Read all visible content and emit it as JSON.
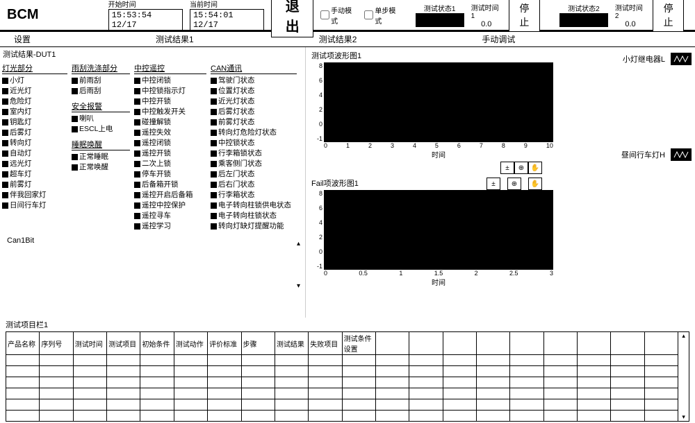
{
  "header": {
    "logo": "BCM",
    "start_time_label": "开始时间",
    "start_time": "15:53:54 12/17",
    "current_time_label": "当前时间",
    "current_time": "15:54:01 12/17",
    "exit": "退出",
    "manual_mode": "手动模式",
    "step_mode": "单步模式",
    "status1_label": "测试状态1",
    "time1_label": "测试时间1",
    "time1_val": "0.0",
    "stop1": "停止",
    "status2_label": "测试状态2",
    "time2_label": "测试时间2",
    "time2_val": "0.0",
    "stop2": "停止"
  },
  "tabs": {
    "t1": "设置",
    "t2": "测试结果1",
    "t3": "测试结果2",
    "t4": "手动调试"
  },
  "left": {
    "title": "测试结果-DUT1",
    "g1_title": "灯光部分",
    "g1": [
      "小灯",
      "近光灯",
      "危险灯",
      "室内灯",
      "钥匙灯",
      "后雾灯",
      "转向灯",
      "自动灯",
      "远光灯",
      "超车灯",
      "前雾灯",
      "伴我回家灯",
      "日间行车灯"
    ],
    "g2_title": "雨刮洗涤部分",
    "g2": [
      "前雨刮",
      "后雨刮"
    ],
    "g3_title": "安全报警",
    "g3": [
      "喇叭",
      "ESCL上电"
    ],
    "g4_title": "睡眠唤醒",
    "g4": [
      "正常睡眠",
      "正常唤醒"
    ],
    "g5_title": "中控遥控",
    "g5": [
      "中控闭锁",
      "中控锁指示灯",
      "中控开锁",
      "中控触发开关",
      "碰撞解锁",
      "遥控失效",
      "遥控闭锁",
      "遥控开锁",
      "二次上锁",
      "停车开锁",
      "后备箱开锁",
      "遥控开启后备箱",
      "遥控中控保护",
      "遥控寻车",
      "遥控学习"
    ],
    "g6_title": "CAN通讯",
    "g6": [
      "驾驶门状态",
      "位置灯状态",
      "近光灯状态",
      "后雾灯状态",
      "前雾灯状态",
      "转向灯危险灯状态",
      "中控锁状态",
      "行李箱锁状态",
      "乘客侧门状态",
      "后左门状态",
      "后右门状态",
      "行李箱状态",
      "电子转向柱锁供电状态",
      "电子转向柱锁状态",
      "转向灯缺灯提醒功能"
    ],
    "canbit": "Can1Bit"
  },
  "mid": {
    "title1": "测试项波形图1",
    "title2": "Fail项波形图1",
    "xlabel": "时间",
    "tb1": "±",
    "tb2": "⊕",
    "tb3": "✋"
  },
  "right": {
    "relay1": "小灯继电器L",
    "relay2": "昼间行车灯H"
  },
  "table": {
    "title": "测试项目栏1",
    "headers": [
      "产品名称",
      "序列号",
      "测试时间",
      "测试项目",
      "初始条件",
      "测试动作",
      "评价标准",
      "步骤",
      "测试结果",
      "失败项目",
      "测试条件设置"
    ]
  },
  "chart_data": [
    {
      "type": "line",
      "title": "测试项波形图1",
      "x": [
        0,
        1,
        2,
        3,
        4,
        5,
        6,
        7,
        8,
        9,
        10
      ],
      "series": [],
      "xlabel": "时间",
      "ylim": [
        -1,
        8
      ],
      "yticks": [
        8,
        6,
        4,
        2,
        0,
        -1
      ]
    },
    {
      "type": "line",
      "title": "Fail项波形图1",
      "x": [
        0,
        0.5,
        1,
        1.5,
        2,
        2.5,
        3
      ],
      "series": [],
      "xlabel": "时间",
      "ylim": [
        -1,
        8
      ],
      "yticks": [
        8,
        6,
        4,
        2,
        0,
        -1
      ]
    }
  ]
}
